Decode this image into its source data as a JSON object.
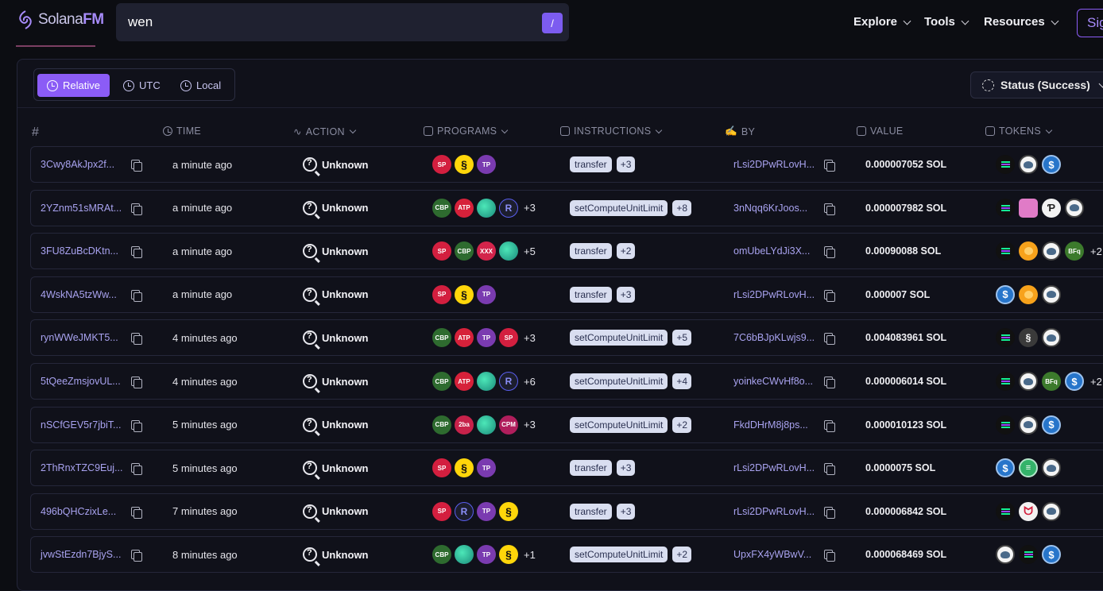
{
  "app": {
    "logo_prefix": "Solana",
    "logo_suffix": "FM"
  },
  "search": {
    "value": "wen",
    "shortcut": "/"
  },
  "nav": {
    "explore": "Explore",
    "tools": "Tools",
    "resources": "Resources",
    "signin": "Sig"
  },
  "timezone": {
    "relative": "Relative",
    "utc": "UTC",
    "local": "Local"
  },
  "status_filter": "Status (Success)",
  "columns": {
    "hash": "#",
    "time": "TIME",
    "action": "ACTION",
    "programs": "PROGRAMS",
    "instructions": "INSTRUCTIONS",
    "by": "BY",
    "value": "VALUE",
    "tokens": "TOKENS"
  },
  "rows": [
    {
      "sig": "3Cwy8AkJpx2f...",
      "time": "a minute ago",
      "action": "Unknown",
      "programs": [
        "SP",
        "JUP",
        "TP"
      ],
      "programs_more": "",
      "instr": "transfer",
      "instr_more": "+3",
      "by": "rLsi2DPwRLovH...",
      "value": "0.000007052 SOL",
      "tokens": [
        "sol",
        "wen",
        "usdc"
      ],
      "tokens_more": ""
    },
    {
      "sig": "2YZnm51sMRAt...",
      "time": "a minute ago",
      "action": "Unknown",
      "programs": [
        "CBP",
        "ATP",
        "WAVE",
        "R"
      ],
      "programs_more": "+3",
      "instr": "setComputeUnitLimit",
      "instr_more": "+8",
      "by": "3nNqq6KrJoos...",
      "value": "0.000007982 SOL",
      "tokens": [
        "sol",
        "cat",
        "white",
        "wen"
      ],
      "tokens_more": ""
    },
    {
      "sig": "3FU8ZuBcDKtn...",
      "time": "a minute ago",
      "action": "Unknown",
      "programs": [
        "SP",
        "CBP",
        "XXX",
        "WAVE"
      ],
      "programs_more": "+5",
      "instr": "transfer",
      "instr_more": "+2",
      "by": "omUbeLYdJi3X...",
      "value": "0.00090088 SOL",
      "tokens": [
        "sol",
        "bonk",
        "wen",
        "bfq"
      ],
      "tokens_more": "+2"
    },
    {
      "sig": "4WskNA5tzWw...",
      "time": "a minute ago",
      "action": "Unknown",
      "programs": [
        "SP",
        "JUP",
        "TP"
      ],
      "programs_more": "",
      "instr": "transfer",
      "instr_more": "+3",
      "by": "rLsi2DPwRLovH...",
      "value": "0.000007 SOL",
      "tokens": [
        "usdc",
        "bonk",
        "wen"
      ],
      "tokens_more": ""
    },
    {
      "sig": "rynWWeJMKT5...",
      "time": "4 minutes ago",
      "action": "Unknown",
      "programs": [
        "CBP",
        "ATP",
        "TP",
        "SP"
      ],
      "programs_more": "+3",
      "instr": "setComputeUnitLimit",
      "instr_more": "+5",
      "by": "7C6bBJpKLwjs9...",
      "value": "0.004083961 SOL",
      "tokens": [
        "sol",
        "gray",
        "wen"
      ],
      "tokens_more": ""
    },
    {
      "sig": "5tQeeZmsjovUL...",
      "time": "4 minutes ago",
      "action": "Unknown",
      "programs": [
        "CBP",
        "ATP",
        "WAVE",
        "R"
      ],
      "programs_more": "+6",
      "instr": "setComputeUnitLimit",
      "instr_more": "+4",
      "by": "yoinkeCWvHf8o...",
      "value": "0.000006014 SOL",
      "tokens": [
        "sol",
        "wen",
        "bfq",
        "usdc"
      ],
      "tokens_more": "+2"
    },
    {
      "sig": "nSCfGEV5r7jbiT...",
      "time": "5 minutes ago",
      "action": "Unknown",
      "programs": [
        "CBP",
        "2ba",
        "WAVE",
        "CPM"
      ],
      "programs_more": "+3",
      "instr": "setComputeUnitLimit",
      "instr_more": "+2",
      "by": "FkdDHrM8j8ps...",
      "value": "0.000010123 SOL",
      "tokens": [
        "sol",
        "wen",
        "usdc"
      ],
      "tokens_more": ""
    },
    {
      "sig": "2ThRnxTZC9Euj...",
      "time": "5 minutes ago",
      "action": "Unknown",
      "programs": [
        "SP",
        "JUP",
        "TP"
      ],
      "programs_more": "",
      "instr": "transfer",
      "instr_more": "+3",
      "by": "rLsi2DPwRLovH...",
      "value": "0.0000075 SOL",
      "tokens": [
        "usdc",
        "green",
        "wen"
      ],
      "tokens_more": ""
    },
    {
      "sig": "496bQHCzixLe...",
      "time": "7 minutes ago",
      "action": "Unknown",
      "programs": [
        "SP",
        "R",
        "TP",
        "JUP"
      ],
      "programs_more": "",
      "instr": "transfer",
      "instr_more": "+3",
      "by": "rLsi2DPwRLovH...",
      "value": "0.000006842 SOL",
      "tokens": [
        "sol",
        "fox",
        "wen"
      ],
      "tokens_more": ""
    },
    {
      "sig": "jvwStEzdn7BjyS...",
      "time": "8 minutes ago",
      "action": "Unknown",
      "programs": [
        "CBP",
        "WAVE",
        "TP",
        "JUP"
      ],
      "programs_more": "+1",
      "instr": "setComputeUnitLimit",
      "instr_more": "+2",
      "by": "UpxFX4yWBwV...",
      "value": "0.000068469 SOL",
      "tokens": [
        "wen",
        "sol",
        "usdc"
      ],
      "tokens_more": ""
    }
  ]
}
